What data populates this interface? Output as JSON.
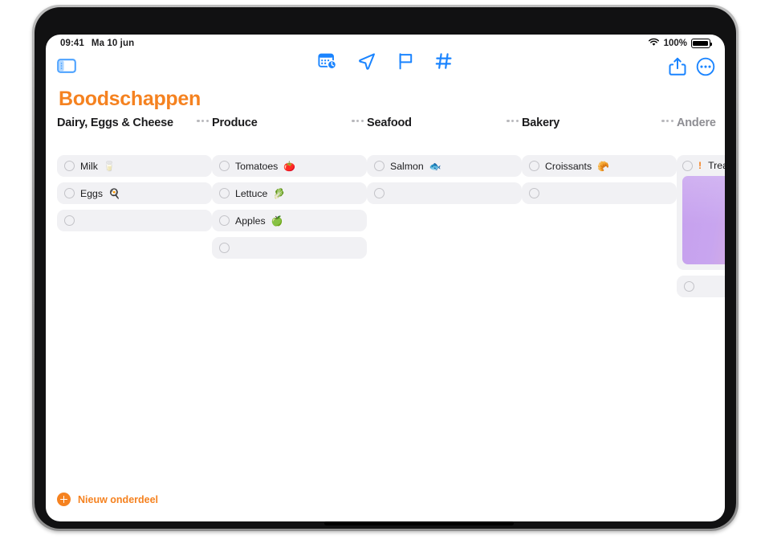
{
  "status_bar": {
    "time": "09:41",
    "date": "Ma 10 jun",
    "wifi_icon": "wifi-icon",
    "battery_percent": "100%",
    "battery_icon": "battery-full-icon"
  },
  "toolbar": {
    "sidebar_toggle_icon": "sidebar-toggle-icon",
    "center_items": [
      {
        "icon": "calendar-clock-icon",
        "name": "schedule-button"
      },
      {
        "icon": "location-arrow-icon",
        "name": "location-button"
      },
      {
        "icon": "flag-icon",
        "name": "flag-button"
      },
      {
        "icon": "hashtag-icon",
        "name": "tag-button"
      }
    ],
    "share_icon": "share-icon",
    "more_icon": "more-circle-icon",
    "multitask_icon": "multitasking-dots-icon"
  },
  "page_title": "Boodschappen",
  "accent_color": "#F58220",
  "columns": [
    {
      "title": "Dairy, Eggs & Cheese",
      "muted": false,
      "items": [
        {
          "text": "Milk",
          "emoji": "🥛",
          "priority": ""
        },
        {
          "text": "Eggs",
          "emoji": "🍳",
          "priority": ""
        }
      ],
      "empty_row": true,
      "menu_label": "···"
    },
    {
      "title": "Produce",
      "muted": false,
      "items": [
        {
          "text": "Tomatoes",
          "emoji": "🍅",
          "priority": ""
        },
        {
          "text": "Lettuce",
          "emoji": "🥬",
          "priority": ""
        },
        {
          "text": "Apples",
          "emoji": "🍏",
          "priority": ""
        }
      ],
      "empty_row": true,
      "menu_label": "···"
    },
    {
      "title": "Seafood",
      "muted": false,
      "items": [
        {
          "text": "Salmon",
          "emoji": "🐟",
          "priority": ""
        }
      ],
      "empty_row": true,
      "menu_label": "···"
    },
    {
      "title": "Bakery",
      "muted": false,
      "items": [
        {
          "text": "Croissants",
          "emoji": "🥐",
          "priority": ""
        }
      ],
      "empty_row": true,
      "menu_label": "···"
    },
    {
      "title": "Andere",
      "muted": true,
      "items": [
        {
          "text": "Treats for t",
          "emoji": "",
          "priority": "!",
          "image": "popsicle-photo"
        }
      ],
      "empty_row": true,
      "menu_label": ""
    }
  ],
  "new_item": {
    "label": "Nieuw onderdeel",
    "icon": "plus-circle-icon"
  }
}
